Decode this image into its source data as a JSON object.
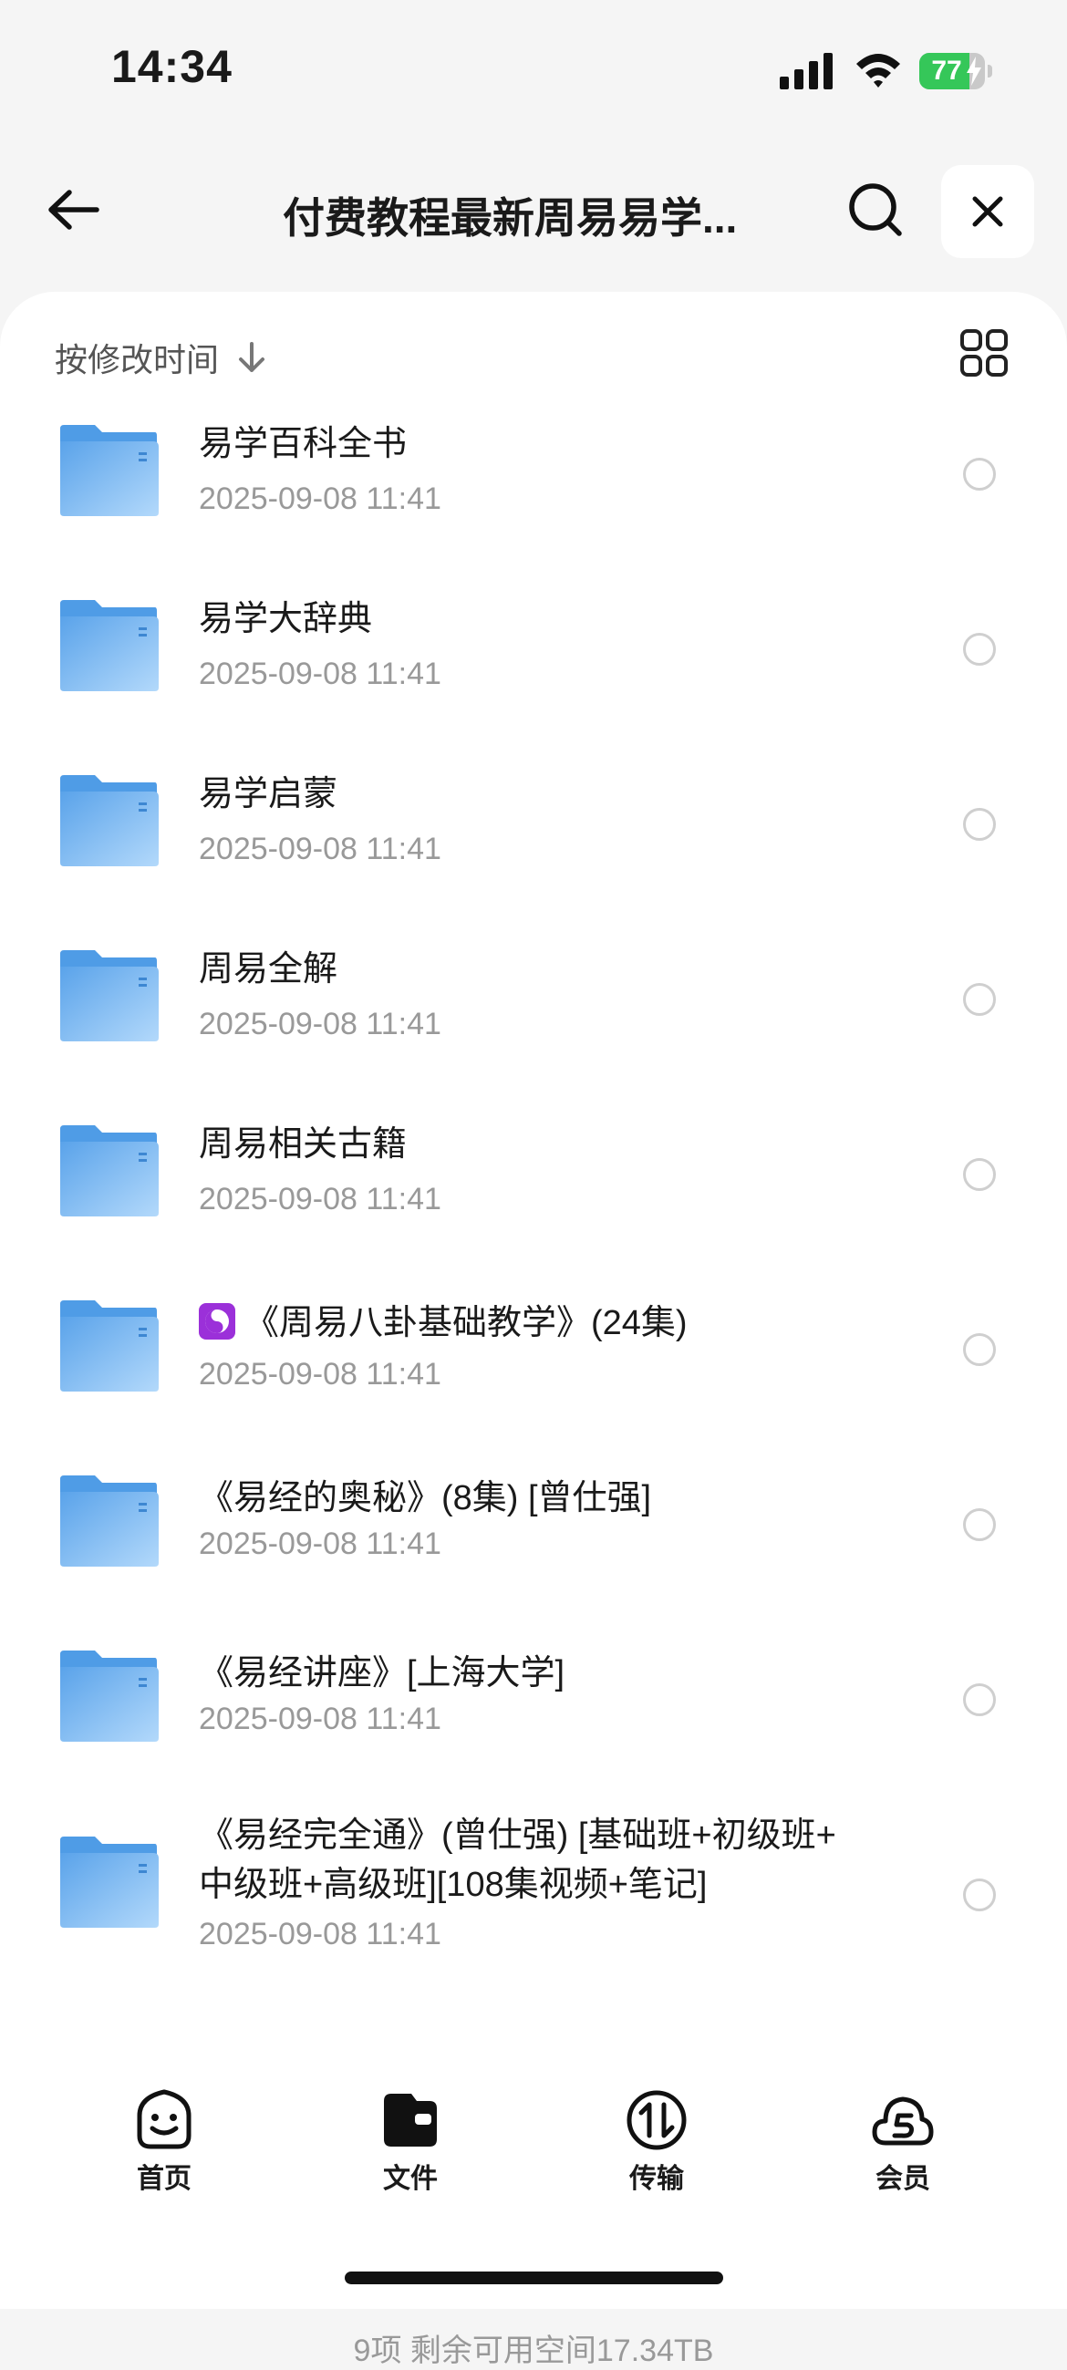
{
  "status": {
    "time": "14:34",
    "battery_level": 77,
    "battery_text": "77"
  },
  "header": {
    "title": "付费教程最新周易易学..."
  },
  "sort": {
    "label": "按修改时间"
  },
  "files": [
    {
      "name": "易学百科全书",
      "date": "2025-09-08 11:41"
    },
    {
      "name": "易学大辞典",
      "date": "2025-09-08 11:41"
    },
    {
      "name": "易学启蒙",
      "date": "2025-09-08 11:41"
    },
    {
      "name": "周易全解",
      "date": "2025-09-08 11:41"
    },
    {
      "name": "周易相关古籍",
      "date": "2025-09-08 11:41"
    },
    {
      "name": "《周易八卦基础教学》(24集)",
      "date": "2025-09-08 11:41"
    },
    {
      "name": "《易经的奥秘》(8集) [曾仕强]",
      "date": "2025-09-08 11:41"
    },
    {
      "name": "《易经讲座》[上海大学]",
      "date": "2025-09-08 11:41"
    },
    {
      "name_line1": "《易经完全通》(曾仕强) [基础班+初级班+",
      "name_line2": "中级班+高级班][108集视频+笔记]",
      "date": "2025-09-08 11:41"
    }
  ],
  "summary": "9项 剩余可用空间17.34TB",
  "tabs": [
    {
      "label": "首页",
      "icon": "smile-face-icon"
    },
    {
      "label": "文件",
      "icon": "wallet-folder-icon"
    },
    {
      "label": "传输",
      "icon": "transfer-icon"
    },
    {
      "label": "会员",
      "icon": "vip-cloud-icon"
    }
  ],
  "colors": {
    "folder": "#5aa7ee",
    "battery": "#35c759"
  }
}
